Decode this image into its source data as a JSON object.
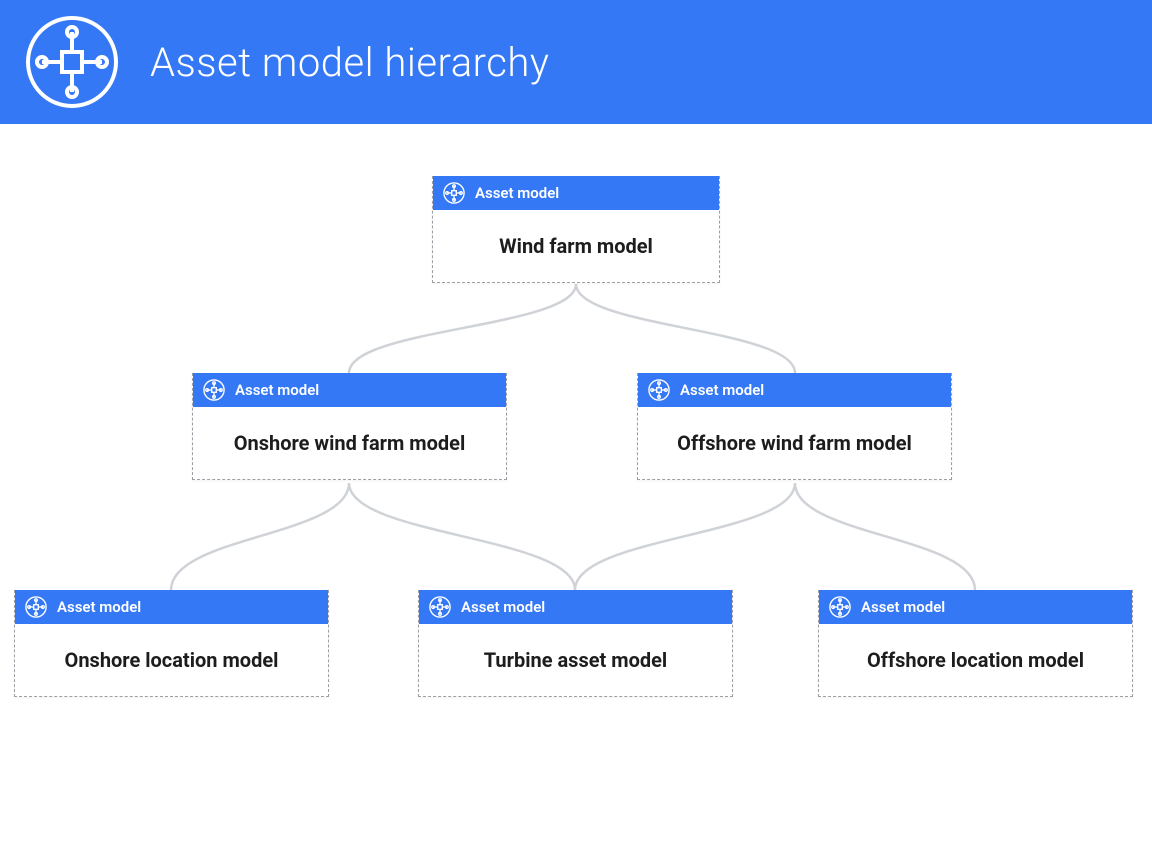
{
  "colors": {
    "primary": "#3478f6",
    "connector": "#cfd3d7",
    "node_border": "#9aa0a6",
    "text": "#1d1d1d"
  },
  "header": {
    "title": "Asset model hierarchy"
  },
  "node_header_label": "Asset model",
  "diagram": {
    "tier1": {
      "label": "Wind farm model"
    },
    "tier2": {
      "left": {
        "label": "Onshore wind farm model"
      },
      "right": {
        "label": "Offshore wind farm model"
      }
    },
    "tier3": {
      "left": {
        "label": "Onshore location model"
      },
      "center": {
        "label": "Turbine asset model"
      },
      "right": {
        "label": "Offshore location model"
      }
    },
    "edges": [
      {
        "from": "tier1",
        "to": "tier2.left"
      },
      {
        "from": "tier1",
        "to": "tier2.right"
      },
      {
        "from": "tier2.left",
        "to": "tier3.left"
      },
      {
        "from": "tier2.left",
        "to": "tier3.center"
      },
      {
        "from": "tier2.right",
        "to": "tier3.center"
      },
      {
        "from": "tier2.right",
        "to": "tier3.right"
      }
    ]
  }
}
